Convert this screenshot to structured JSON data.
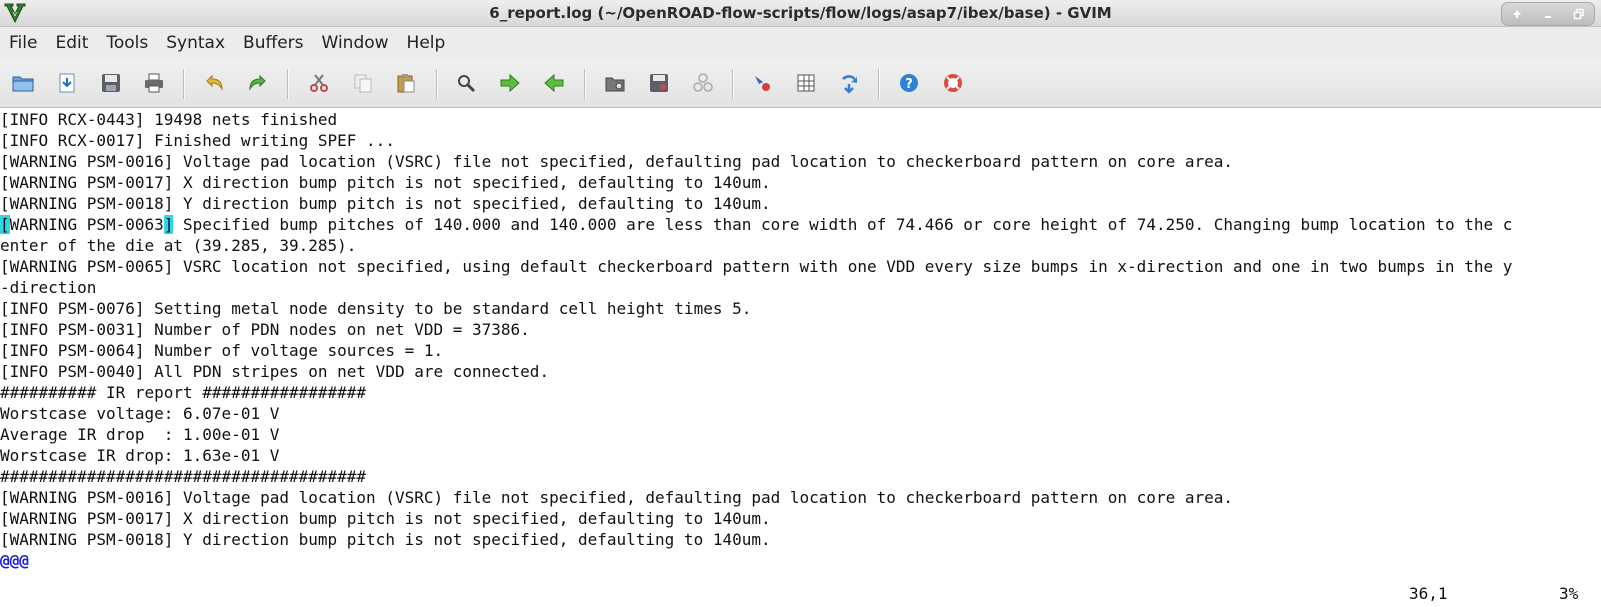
{
  "window": {
    "title": "6_report.log (~/OpenROAD-flow-scripts/flow/logs/asap7/ibex/base) - GVIM"
  },
  "menu": [
    "File",
    "Edit",
    "Tools",
    "Syntax",
    "Buffers",
    "Window",
    "Help"
  ],
  "toolbar": {
    "icons": [
      "open-file-icon",
      "save-down-icon",
      "save-icon",
      "print-icon",
      "undo-icon",
      "redo-icon",
      "cut-icon",
      "copy-icon",
      "paste-icon",
      "find-icon",
      "find-next-icon",
      "find-prev-icon",
      "load-session-icon",
      "save-session-icon",
      "run-script-icon",
      "make-icon",
      "shell-icon",
      "ctags-icon",
      "help-icon",
      "find-help-icon"
    ]
  },
  "editor": {
    "lines": [
      "[INFO RCX-0443] 19498 nets finished",
      "[INFO RCX-0017] Finished writing SPEF ...",
      "[WARNING PSM-0016] Voltage pad location (VSRC) file not specified, defaulting pad location to checkerboard pattern on core area.",
      "[WARNING PSM-0017] X direction bump pitch is not specified, defaulting to 140um.",
      "[WARNING PSM-0018] Y direction bump pitch is not specified, defaulting to 140um.",
      "[WARNING PSM-0063] Specified bump pitches of 140.000 and 140.000 are less than core width of 74.466 or core height of 74.250. Changing bump location to the c",
      "enter of the die at (39.285, 39.285).",
      "[WARNING PSM-0065] VSRC location not specified, using default checkerboard pattern with one VDD every size bumps in x-direction and one in two bumps in the y",
      "-direction",
      "[INFO PSM-0076] Setting metal node density to be standard cell height times 5.",
      "[INFO PSM-0031] Number of PDN nodes on net VDD = 37386.",
      "[INFO PSM-0064] Number of voltage sources = 1.",
      "[INFO PSM-0040] All PDN stripes on net VDD are connected.",
      "########## IR report #################",
      "Worstcase voltage: 6.07e-01 V",
      "Average IR drop  : 1.00e-01 V",
      "Worstcase IR drop: 1.63e-01 V",
      "######################################",
      "[WARNING PSM-0016] Voltage pad location (VSRC) file not specified, defaulting pad location to checkerboard pattern on core area.",
      "[WARNING PSM-0017] X direction bump pitch is not specified, defaulting to 140um.",
      "[WARNING PSM-0018] Y direction bump pitch is not specified, defaulting to 140um."
    ],
    "cursor_line": {
      "before": "",
      "cursor_char": "[",
      "middle": "WARNING PSM-0063",
      "cursor_char2": "]",
      "after": " Specified bump pitches of 140.000 and 140.000 are less than core width of 74.466 or core height of 74.250. Changing bump location to the c"
    },
    "filler": "@@@"
  },
  "status": {
    "position": "36,1",
    "percent": "3%"
  }
}
